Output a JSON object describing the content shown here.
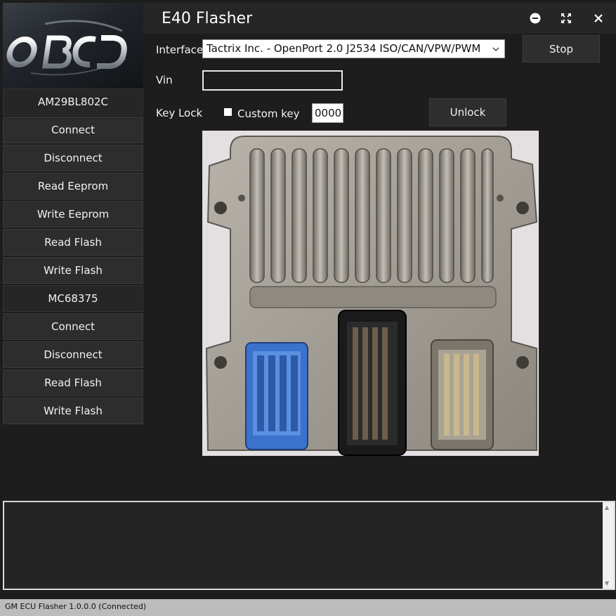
{
  "app": {
    "title": "E40 Flasher",
    "logo_text": "OBCD"
  },
  "sidebar": {
    "groups": [
      {
        "header": "AM29BL802C",
        "buttons": [
          "Connect",
          "Disconnect",
          "Read Eeprom",
          "Write Eeprom",
          "Read Flash",
          "Write Flash"
        ]
      },
      {
        "header": "MC68375",
        "buttons": [
          "Connect",
          "Disconnect",
          "Read Flash",
          "Write Flash"
        ]
      }
    ]
  },
  "form": {
    "interface_label": "Interface",
    "interface_value": "Tactrix Inc. - OpenPort 2.0 J2534 ISO/CAN/VPW/PWM",
    "stop_label": "Stop",
    "vin_label": "Vin",
    "vin_value": "",
    "keylock_label": "Key Lock",
    "custom_key_label": "Custom key",
    "custom_key_checked": false,
    "key_value": "0000",
    "unlock_label": "Unlock"
  },
  "image": {
    "description_icon": "ecu-module-photo"
  },
  "log": {
    "content": ""
  },
  "status": {
    "text": "GM ECU Flasher 1.0.0.0 (Connected)"
  },
  "icons": [
    "minimize-icon",
    "maximize-icon",
    "close-icon",
    "chevron-down-icon",
    "scroll-up-icon",
    "scroll-down-icon"
  ],
  "colors": {
    "background": "#1d1d1d",
    "panel": "#2d2d2d",
    "status_bar": "#bcbcbc",
    "connector_blue": "#3a6fc8"
  }
}
